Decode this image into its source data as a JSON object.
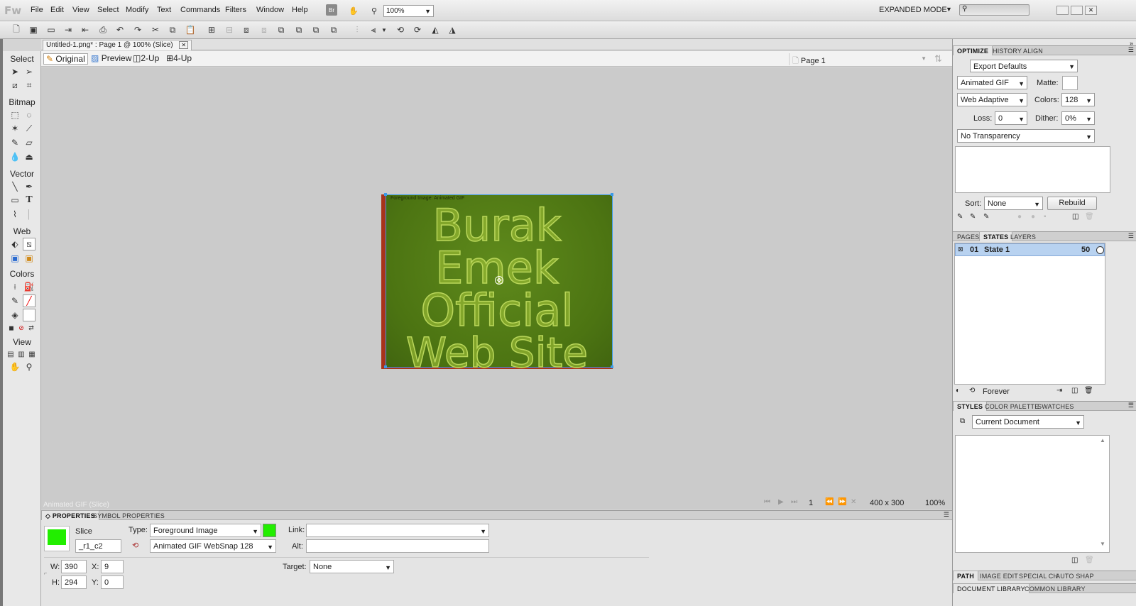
{
  "app": {
    "logo": "Fw",
    "menus": [
      "File",
      "Edit",
      "View",
      "Select",
      "Modify",
      "Text",
      "Commands",
      "Filters",
      "Window",
      "Help"
    ],
    "br_label": "Br",
    "zoom_combo": "100%",
    "mode": "EXPANDED MODE"
  },
  "document": {
    "tab_title": "Untitled-1.png* : Page 1 @ 100% (Slice)",
    "view_buttons": [
      "Original",
      "Preview",
      "2-Up",
      "4-Up"
    ],
    "page_selector": "Page 1",
    "slice_overlay_label": "Foreground Image: Animated GIF",
    "artwork_lines": [
      "Burak",
      "Emek",
      "Official",
      "Web Site"
    ]
  },
  "tools": {
    "sections": [
      "Select",
      "Bitmap",
      "Vector",
      "Web",
      "Colors",
      "View"
    ]
  },
  "status": {
    "selection_text": "Animated GIF (Slice)",
    "frame_number": "1",
    "doc_size": "400 x 300",
    "zoom": "100%"
  },
  "properties": {
    "tabs": [
      "PROPERTIES",
      "SYMBOL PROPERTIES"
    ],
    "object_type": "Slice",
    "slice_name": "_r1_c2",
    "type_label": "Type:",
    "type_value": "Foreground Image",
    "export_setting": "Animated GIF WebSnap 128",
    "link_label": "Link:",
    "link_value": "",
    "alt_label": "Alt:",
    "alt_value": "",
    "target_label": "Target:",
    "target_value": "None",
    "w_label": "W:",
    "w_value": "390",
    "h_label": "H:",
    "h_value": "294",
    "x_label": "X:",
    "x_value": "9",
    "y_label": "Y:",
    "y_value": "0",
    "slice_color": "#22ee00"
  },
  "optimize": {
    "tabs": [
      "OPTIMIZE",
      "HISTORY",
      "ALIGN"
    ],
    "preset": "Export Defaults",
    "format": "Animated GIF",
    "matte_label": "Matte:",
    "palette": "Web Adaptive",
    "colors_label": "Colors:",
    "colors_value": "128",
    "loss_label": "Loss:",
    "loss_value": "0",
    "dither_label": "Dither:",
    "dither_value": "0%",
    "transparency": "No Transparency",
    "sort_label": "Sort:",
    "sort_value": "None",
    "rebuild_label": "Rebuild"
  },
  "states": {
    "tabs": [
      "PAGES",
      "STATES",
      "LAYERS"
    ],
    "row_number": "01",
    "row_name": "State 1",
    "row_delay": "50",
    "loop_label": "Forever"
  },
  "styles": {
    "tabs": [
      "STYLES",
      "COLOR PALETTE",
      "SWATCHES"
    ],
    "library": "Current Document"
  },
  "bottom_tabs": {
    "row1": [
      "PATH",
      "IMAGE EDIT",
      "SPECIAL CH",
      "AUTO SHAP"
    ],
    "row2": [
      "DOCUMENT LIBRARY",
      "COMMON LIBRARY"
    ]
  },
  "colors": {
    "selection_blue": "#b8d2f0",
    "slice_green": "#22ee00",
    "artwork_border": "#a8331b"
  }
}
